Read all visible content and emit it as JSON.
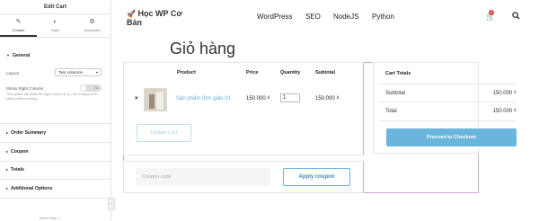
{
  "sidebar": {
    "title": "Edit Cart",
    "tabs": [
      {
        "label": "Content",
        "icon": "pencil-icon"
      },
      {
        "label": "Style",
        "icon": "half-circle-icon"
      },
      {
        "label": "Advanced",
        "icon": "gear-icon"
      }
    ],
    "general": {
      "title": "General",
      "layout_label": "Layout",
      "layout_value": "Two columns",
      "sticky_label": "Sticky Right Column",
      "sticky_toggle": "No",
      "sticky_note": "This option will allow the right column (e.g, Cart Totals) to be sticky while scrolling."
    },
    "sections": [
      "Order Summary",
      "Coupon",
      "Totals",
      "Additional Options"
    ],
    "help": "Need Help ⓘ"
  },
  "header": {
    "logo": "Học WP Cơ Bản",
    "nav": [
      "WordPress",
      "SEO",
      "NodeJS",
      "Python"
    ],
    "cart_count": "0"
  },
  "page": {
    "title": "Giỏ hàng"
  },
  "cart": {
    "headers": {
      "product": "Product",
      "price": "Price",
      "quantity": "Quantity",
      "subtotal": "Subtotal"
    },
    "items": [
      {
        "name": "Sản phẩm đơn giản 01",
        "price": "150.000 ₫",
        "quantity": "1",
        "subtotal": "150.000 ₫"
      }
    ],
    "remove_symbol": "×",
    "update_button": "Update Cart",
    "coupon_placeholder": "Coupon code",
    "coupon_button": "Apply coupon"
  },
  "totals": {
    "title": "Cart Totals",
    "subtotal_label": "Subtotal",
    "subtotal_value": "150.000 ₫",
    "total_label": "Total",
    "total_value": "150.000 ₫",
    "checkout_button": "Proceed to Checkout"
  }
}
